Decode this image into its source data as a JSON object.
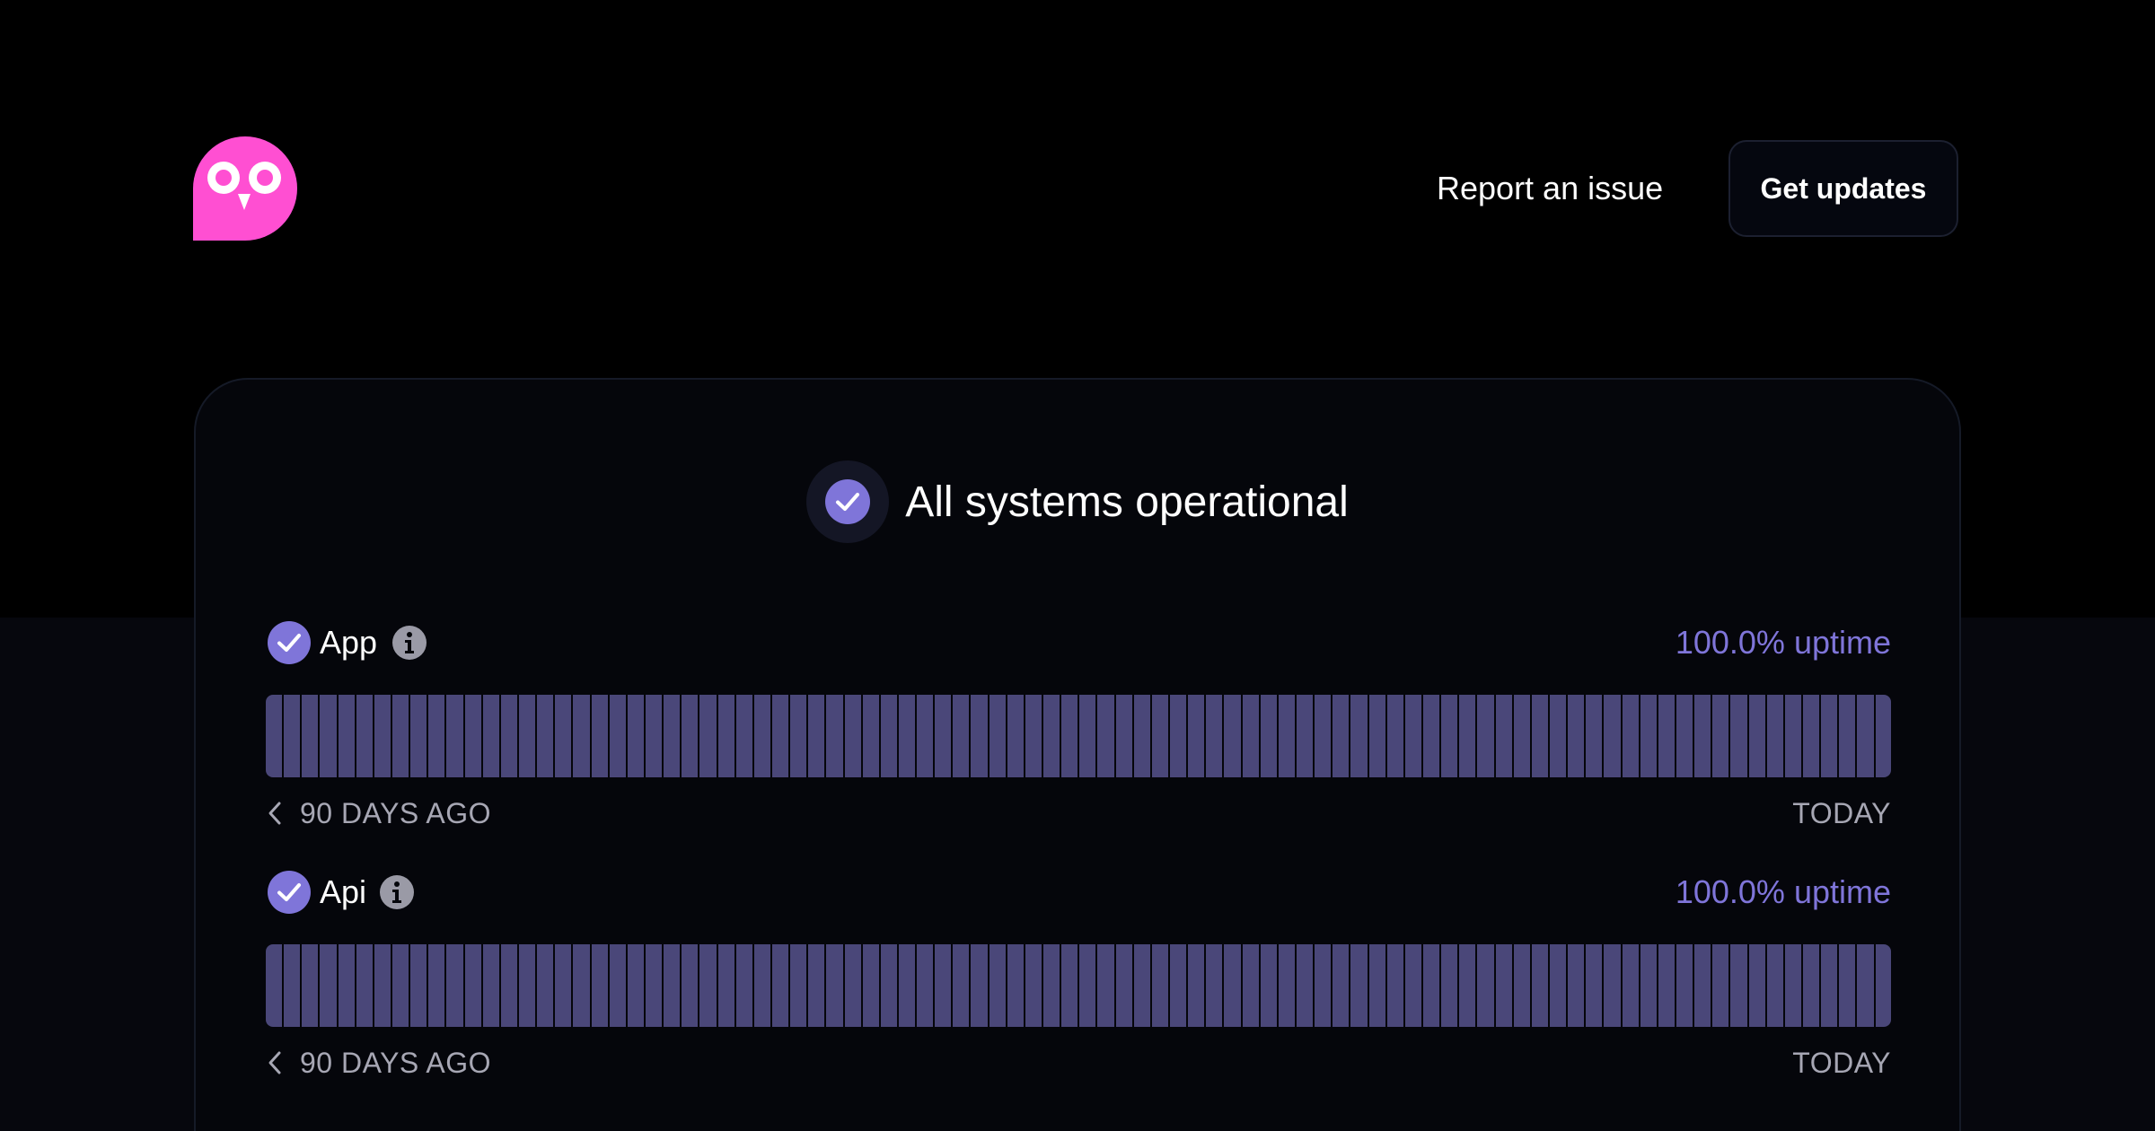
{
  "header": {
    "logo_icon": "owl-logo",
    "report_label": "Report an issue",
    "updates_label": "Get updates"
  },
  "status": {
    "title": "All systems operational",
    "icon": "check-circle-icon"
  },
  "components": [
    {
      "name": "App",
      "uptime": "100.0% uptime",
      "uptime_fraction": 1.0,
      "days": 90,
      "range_start": "90 DAYS AGO",
      "range_end": "TODAY"
    },
    {
      "name": "Api",
      "uptime": "100.0% uptime",
      "uptime_fraction": 1.0,
      "days": 90,
      "range_start": "90 DAYS AGO",
      "range_end": "TODAY"
    }
  ],
  "colors": {
    "brand_pink": "#ff4fd2",
    "accent_purple": "#7f75d9",
    "bar_operational": "#4a4779",
    "background": "#000000"
  }
}
